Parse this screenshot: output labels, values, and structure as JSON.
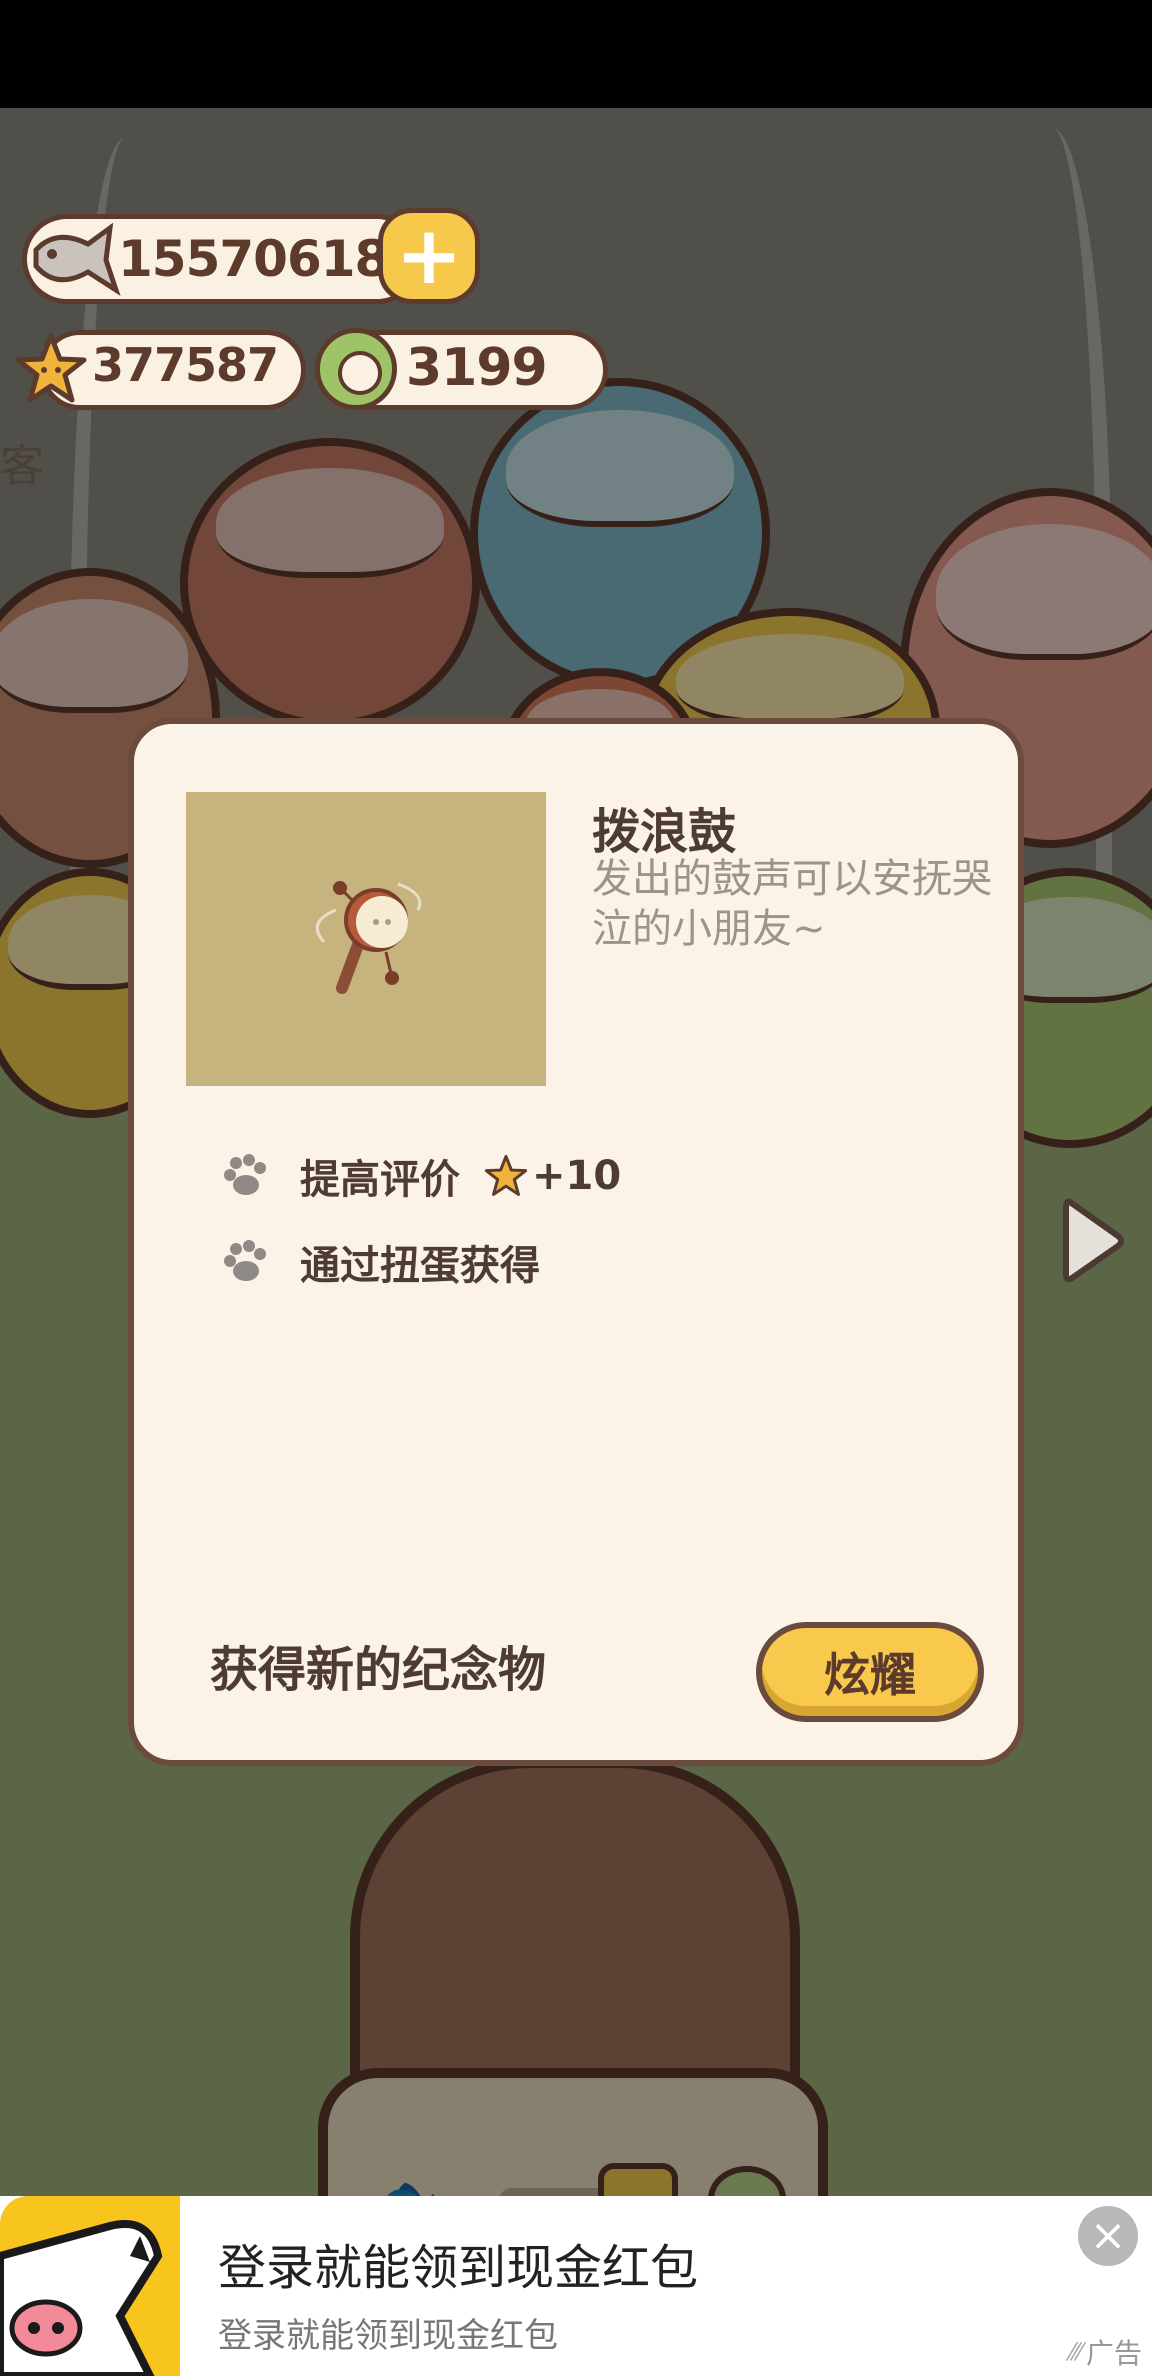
{
  "header": {
    "fish_count": "155706185",
    "star_count": "377587",
    "ring_count": "3199",
    "side_text": "客"
  },
  "dialog": {
    "item_title": "拨浪鼓",
    "item_desc": "发出的鼓声可以安抚哭泣的小朋友~",
    "attributes": [
      {
        "label": "提高评价",
        "bonus": "+10"
      },
      {
        "label": "通过扭蛋获得"
      }
    ],
    "footer_label": "获得新的纪念物",
    "show_button": "炫耀"
  },
  "ad": {
    "title": "登录就能领到现金红包",
    "subtitle": "登录就能领到现金红包",
    "tag": "广告"
  },
  "colors": {
    "accent_yellow": "#f8c94c",
    "text_brown": "#4e3c32",
    "dialog_bg": "#fbf3e7",
    "item_image_bg": "#c6b37d"
  },
  "icons": [
    "fish-icon",
    "plus-icon",
    "star-icon",
    "ring-token-icon",
    "paw-icon",
    "rattle-drum-icon",
    "next-arrow-icon",
    "close-icon"
  ]
}
